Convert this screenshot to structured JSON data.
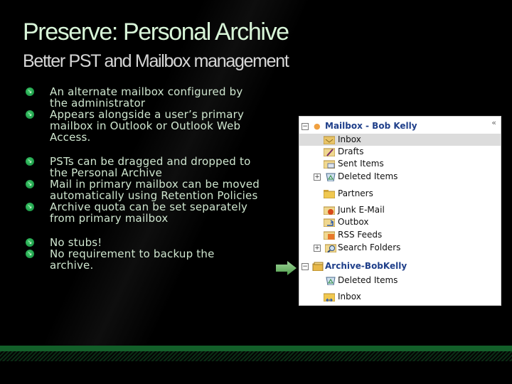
{
  "slide": {
    "title": "Preserve: Personal Archive",
    "subtitle": "Better PST and Mailbox management"
  },
  "bullets": {
    "groups": [
      [
        "An alternate mailbox configured by the administrator",
        "Appears alongside a user’s primary mailbox in Outlook or Outlook Web Access."
      ],
      [
        "PSTs can be dragged and dropped to the Personal Archive",
        "Mail in primary mailbox can be moved automatically using Retention Policies",
        "Archive quota can be set separately from primary mailbox"
      ],
      [
        "No stubs!",
        "No requirement to backup the archive."
      ]
    ],
    "icon": "arrow-bullet-icon"
  },
  "folder_pane": {
    "collapse_glyph": "«",
    "mailbox": {
      "label": "Mailbox - Bob Kelly",
      "expander": "−",
      "folders": [
        {
          "label": "Inbox",
          "icon": "inbox-folder-icon",
          "selected": true
        },
        {
          "label": "Drafts",
          "icon": "drafts-folder-icon"
        },
        {
          "label": "Sent Items",
          "icon": "sent-folder-icon"
        },
        {
          "label": "Deleted Items",
          "icon": "deleted-items-icon",
          "expander": "+"
        },
        {
          "label": "Partners",
          "icon": "folder-icon"
        },
        {
          "label": "Junk E-Mail",
          "icon": "junk-folder-icon"
        },
        {
          "label": "Outbox",
          "icon": "outbox-folder-icon"
        },
        {
          "label": "RSS Feeds",
          "icon": "rss-folder-icon"
        },
        {
          "label": "Search Folders",
          "icon": "search-folder-icon",
          "expander": "+"
        }
      ]
    },
    "archive": {
      "label": "Archive-BobKelly",
      "expander": "−",
      "folders": [
        {
          "label": "Deleted Items",
          "icon": "deleted-items-icon"
        },
        {
          "label": "Inbox",
          "icon": "inbox-folder-icon"
        }
      ]
    }
  },
  "colors": {
    "accent_green": "#13602a",
    "title_color": "#d8f5d8",
    "mailbox_label_color": "#1f3f8a"
  }
}
